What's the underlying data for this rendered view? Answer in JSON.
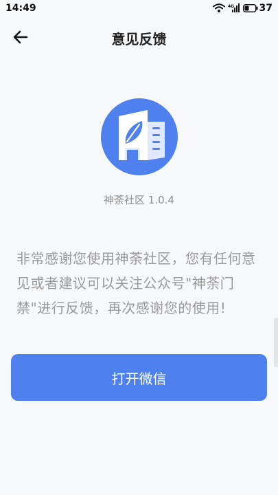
{
  "status_bar": {
    "time": "14:49",
    "network_label": "4G",
    "battery_percent": "37"
  },
  "header": {
    "title": "意见反馈",
    "back_icon": "arrow-left-icon"
  },
  "app_info": {
    "logo_icon": "building-leaf-logo",
    "version": "神荼社区 1.0.4"
  },
  "description": "非常感谢您使用神荼社区，您有任何意见或者建议可以关注公众号\"神荼门禁\"进行反馈，再次感谢您的使用!",
  "actions": {
    "open_wechat_label": "打开微信"
  },
  "colors": {
    "accent": "#4e80ee",
    "background": "#f7f8fa",
    "text_muted": "#9a9a9a"
  }
}
